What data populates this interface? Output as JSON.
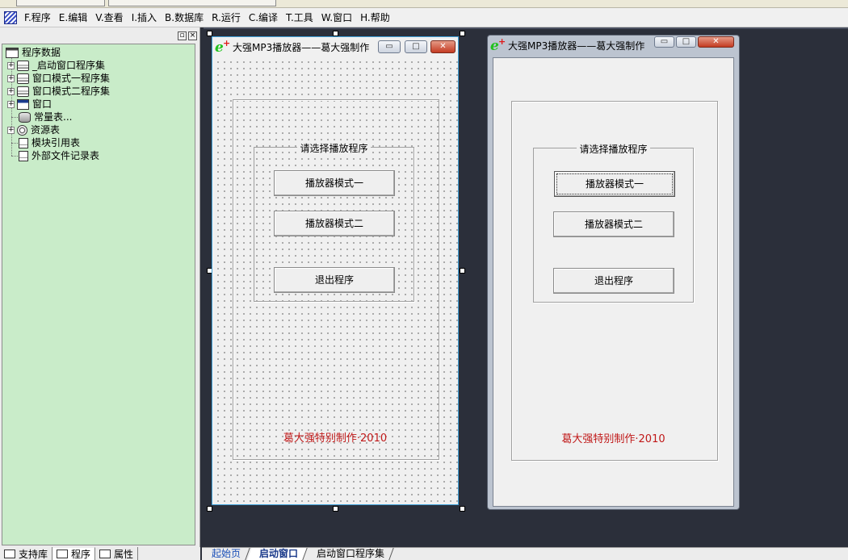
{
  "menu": [
    "F.程序",
    "E.编辑",
    "V.查看",
    "I.插入",
    "B.数据库",
    "R.运行",
    "C.编译",
    "T.工具",
    "W.窗口",
    "H.帮助"
  ],
  "left_pane": {
    "pin_glyph": "▫",
    "close_glyph": "×",
    "tree": {
      "root": "程序数据",
      "items": [
        "_启动窗口程序集",
        "窗口模式一程序集",
        "窗口模式二程序集",
        "窗口",
        "常量表...",
        "资源表",
        "模块引用表",
        "外部文件记录表"
      ]
    },
    "tabs": [
      "支持库",
      "程序",
      "属性"
    ]
  },
  "bottom_tabs": [
    "起始页",
    "启动窗口",
    "启动窗口程序集"
  ],
  "form": {
    "title": "大强MP3播放器——葛大强制作",
    "group_title": "请选择播放程序",
    "buttons": [
      "播放器模式一",
      "播放器模式二",
      "退出程序"
    ],
    "credit": "葛大强特别制作·2010",
    "min_glyph": "▭",
    "max_glyph": "□",
    "close_glyph": "✕"
  },
  "colors": {
    "tree_bg": "#c9ecc9",
    "design_bg": "#2b2f3a",
    "credit": "#c01818",
    "icon_e": "#22c21e"
  }
}
